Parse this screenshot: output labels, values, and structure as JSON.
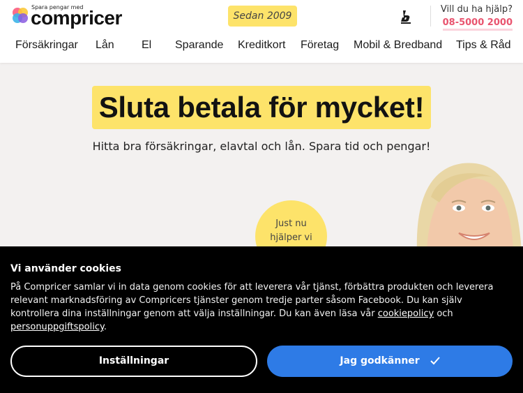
{
  "header": {
    "logo": {
      "tagline": "Spara pengar med",
      "wordmark": "compricer"
    },
    "since_badge": "Sedan 2009",
    "bankid_icon": "bankid-icon",
    "help_label": "Vill du ha hjälp?",
    "help_phone": "08-5000 2000",
    "colors": {
      "accent_yellow": "#fde36a",
      "phone_pink": "#e9546f"
    }
  },
  "nav": {
    "items": [
      "Försäkringar",
      "Lån",
      "El",
      "Sparande",
      "Kreditkort",
      "Företag",
      "Mobil & Bredband",
      "Tips & Råd"
    ]
  },
  "hero": {
    "title": "Sluta betala för mycket!",
    "subtitle": "Hitta bra försäkringar, elavtal och lån. Spara tid och pengar!",
    "help_bubble_line1": "Just nu",
    "help_bubble_line2": "hjälper vi"
  },
  "cookie": {
    "title": "Vi använder cookies",
    "text_before": "På Compricer samlar vi in data genom cookies för att leverera vår tjänst, förbättra produkten och leverera relevant marknadsföring av Compricers tjänster genom tredje parter såsom Facebook. Du kan själv kontrollera dina inställningar genom att välja inställningar. Du kan även läsa vår ",
    "cookie_policy_link": "cookiepolicy",
    "text_middle": " och ",
    "privacy_policy_link": "personuppgiftspolicy",
    "text_after": ".",
    "settings_button": "Inställningar",
    "accept_button": "Jag godkänner",
    "accept_icon": "check-icon",
    "colors": {
      "background": "#000000",
      "accept": "#2e7be6"
    }
  }
}
